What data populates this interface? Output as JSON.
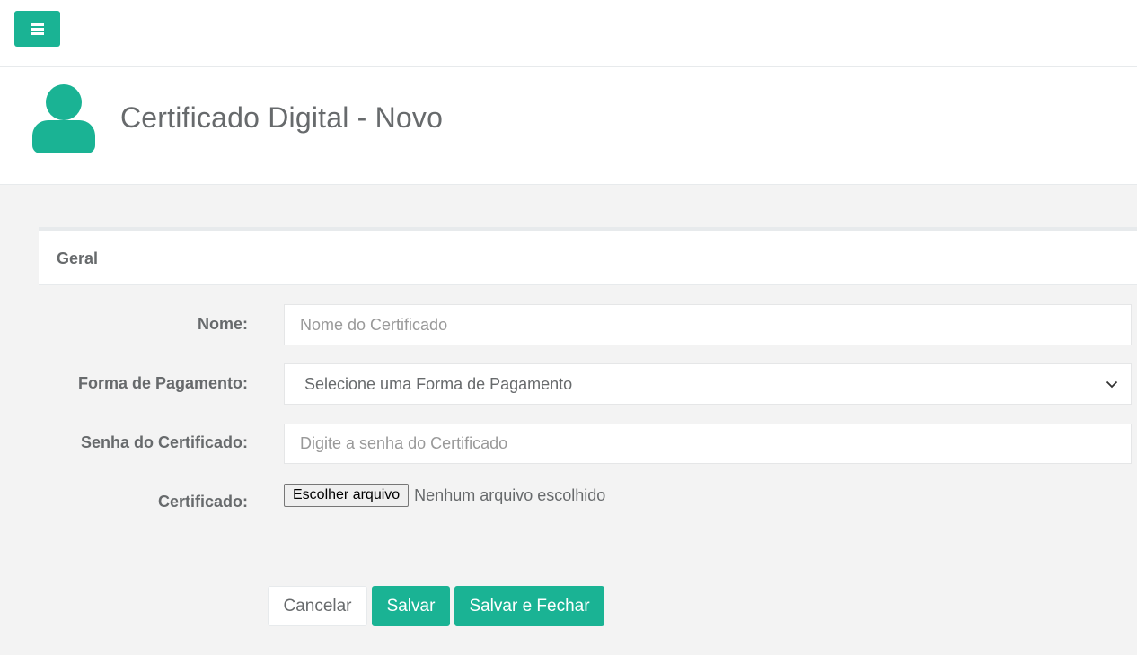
{
  "topbar": {
    "menu_icon": "bars-icon"
  },
  "header": {
    "icon": "user-icon",
    "title": "Certificado Digital - Novo"
  },
  "panel": {
    "title": "Geral"
  },
  "form": {
    "nome": {
      "label": "Nome:",
      "placeholder": "Nome do Certificado",
      "value": ""
    },
    "forma_pagamento": {
      "label": "Forma de Pagamento:",
      "selected": "Selecione uma Forma de Pagamento"
    },
    "senha": {
      "label": "Senha do Certificado:",
      "placeholder": "Digite a senha do Certificado",
      "value": ""
    },
    "certificado": {
      "label": "Certificado:",
      "button_label": "Escolher arquivo",
      "status": "Nenhum arquivo escolhido"
    }
  },
  "actions": {
    "cancel_label": "Cancelar",
    "save_label": "Salvar",
    "save_close_label": "Salvar e Fechar"
  },
  "colors": {
    "accent": "#1ab394",
    "background": "#f3f3f3",
    "text": "#676a6c"
  }
}
